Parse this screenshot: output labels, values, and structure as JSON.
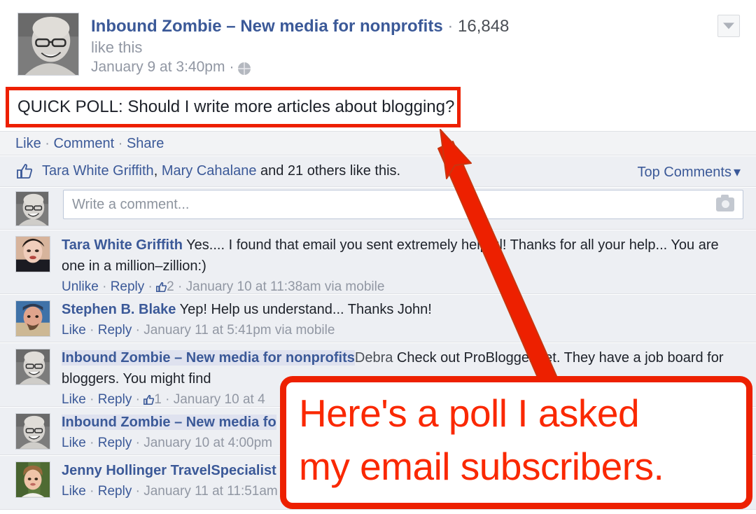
{
  "post": {
    "page_name": "Inbound Zombie – New media for nonprofits",
    "separator": "·",
    "like_count": "16,848",
    "like_this_text": "like this",
    "timestamp": "January 9 at 3:40pm",
    "privacy_icon": "globe-icon",
    "options_icon": "chevron-down-icon",
    "status_text": "QUICK POLL: Should I write more articles about blogging?"
  },
  "actions": {
    "like": "Like",
    "comment": "Comment",
    "share": "Share",
    "dot": "·"
  },
  "likes_row": {
    "thumb_icon": "thumbs-up-icon",
    "person_1": "Tara White Griffith",
    "comma": ", ",
    "person_2": "Mary Cahalane",
    "tail": " and 21 others like this.",
    "sort_label": "Top Comments",
    "sort_caret": "▾"
  },
  "composer": {
    "placeholder": "Write a comment...",
    "camera_icon": "camera-icon"
  },
  "comments": [
    {
      "author": "Tara White Griffith",
      "author_is_page": false,
      "text": " Yes.... I found that email you sent extremely helpful! Thanks for all your help... You are one in a million–zillion:)",
      "like_label": "Unlike",
      "reply_label": "Reply",
      "like_count": "2",
      "timestamp": "January 10 at 11:38am via mobile",
      "avatar_color": "#c98d7a"
    },
    {
      "author": "Stephen B. Blake",
      "author_is_page": false,
      "text": " Yep! Help us understand... Thanks John!",
      "like_label": "Like",
      "reply_label": "Reply",
      "like_count": "",
      "timestamp": "January 11 at 5:41pm via mobile",
      "avatar_color": "#4f7fa8"
    },
    {
      "author": "Inbound Zombie – New media for nonprofits",
      "author_is_page": true,
      "mention": "Debra",
      "text": " Check out ProBlogger.net. They have a job board for bloggers. You might find",
      "like_label": "Like",
      "reply_label": "Reply",
      "like_count": "1",
      "timestamp": "January 10 at 4",
      "avatar_color": "#8d8d8d"
    },
    {
      "author": "Inbound Zombie – New media fo",
      "author_is_page": true,
      "mention": "",
      "text": "",
      "like_label": "Like",
      "reply_label": "Reply",
      "like_count": "",
      "timestamp": "January 10 at 4:00pm",
      "avatar_color": "#8d8d8d"
    },
    {
      "author": "Jenny Hollinger TravelSpecialist",
      "author_is_page": false,
      "mention": "",
      "text": "",
      "like_label": "Like",
      "reply_label": "Reply",
      "like_count": "",
      "timestamp": "January 11 at 11:51am",
      "avatar_color": "#6f8a4c"
    }
  ],
  "annotation": {
    "callout_line1": "Here's a poll I asked",
    "callout_line2": "my email subscribers.",
    "color": "#ED2000",
    "text_color": "#FA2800",
    "arrow_name": "red-arrow-annotation",
    "highlight_name": "red-highlight-box"
  }
}
